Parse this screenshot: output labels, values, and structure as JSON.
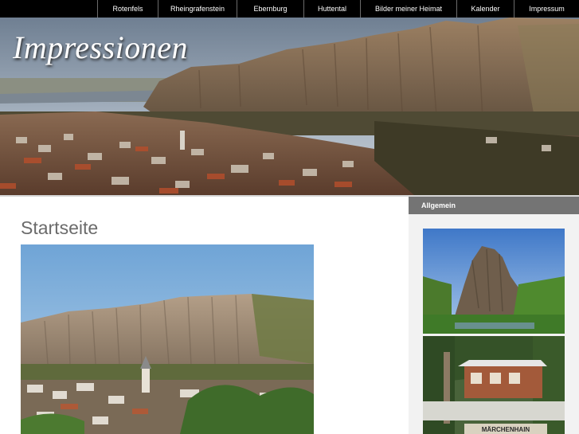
{
  "nav": {
    "items": [
      {
        "label": "Rotenfels"
      },
      {
        "label": "Rheingrafenstein"
      },
      {
        "label": "Ebernburg"
      },
      {
        "label": "Huttental"
      },
      {
        "label": "Bilder meiner Heimat"
      },
      {
        "label": "Kalender"
      },
      {
        "label": "Impressum"
      }
    ]
  },
  "header": {
    "title": "Impressionen"
  },
  "main": {
    "page_title": "Startseite"
  },
  "sidebar": {
    "header": "Allgemein",
    "sign_text": "MÄRCHENHAIN"
  },
  "colors": {
    "nav_bg": "#000000",
    "sidebar_header_bg": "#747474",
    "sidebar_bg": "#f2f2f2",
    "title_gray": "#6b6b6b"
  }
}
